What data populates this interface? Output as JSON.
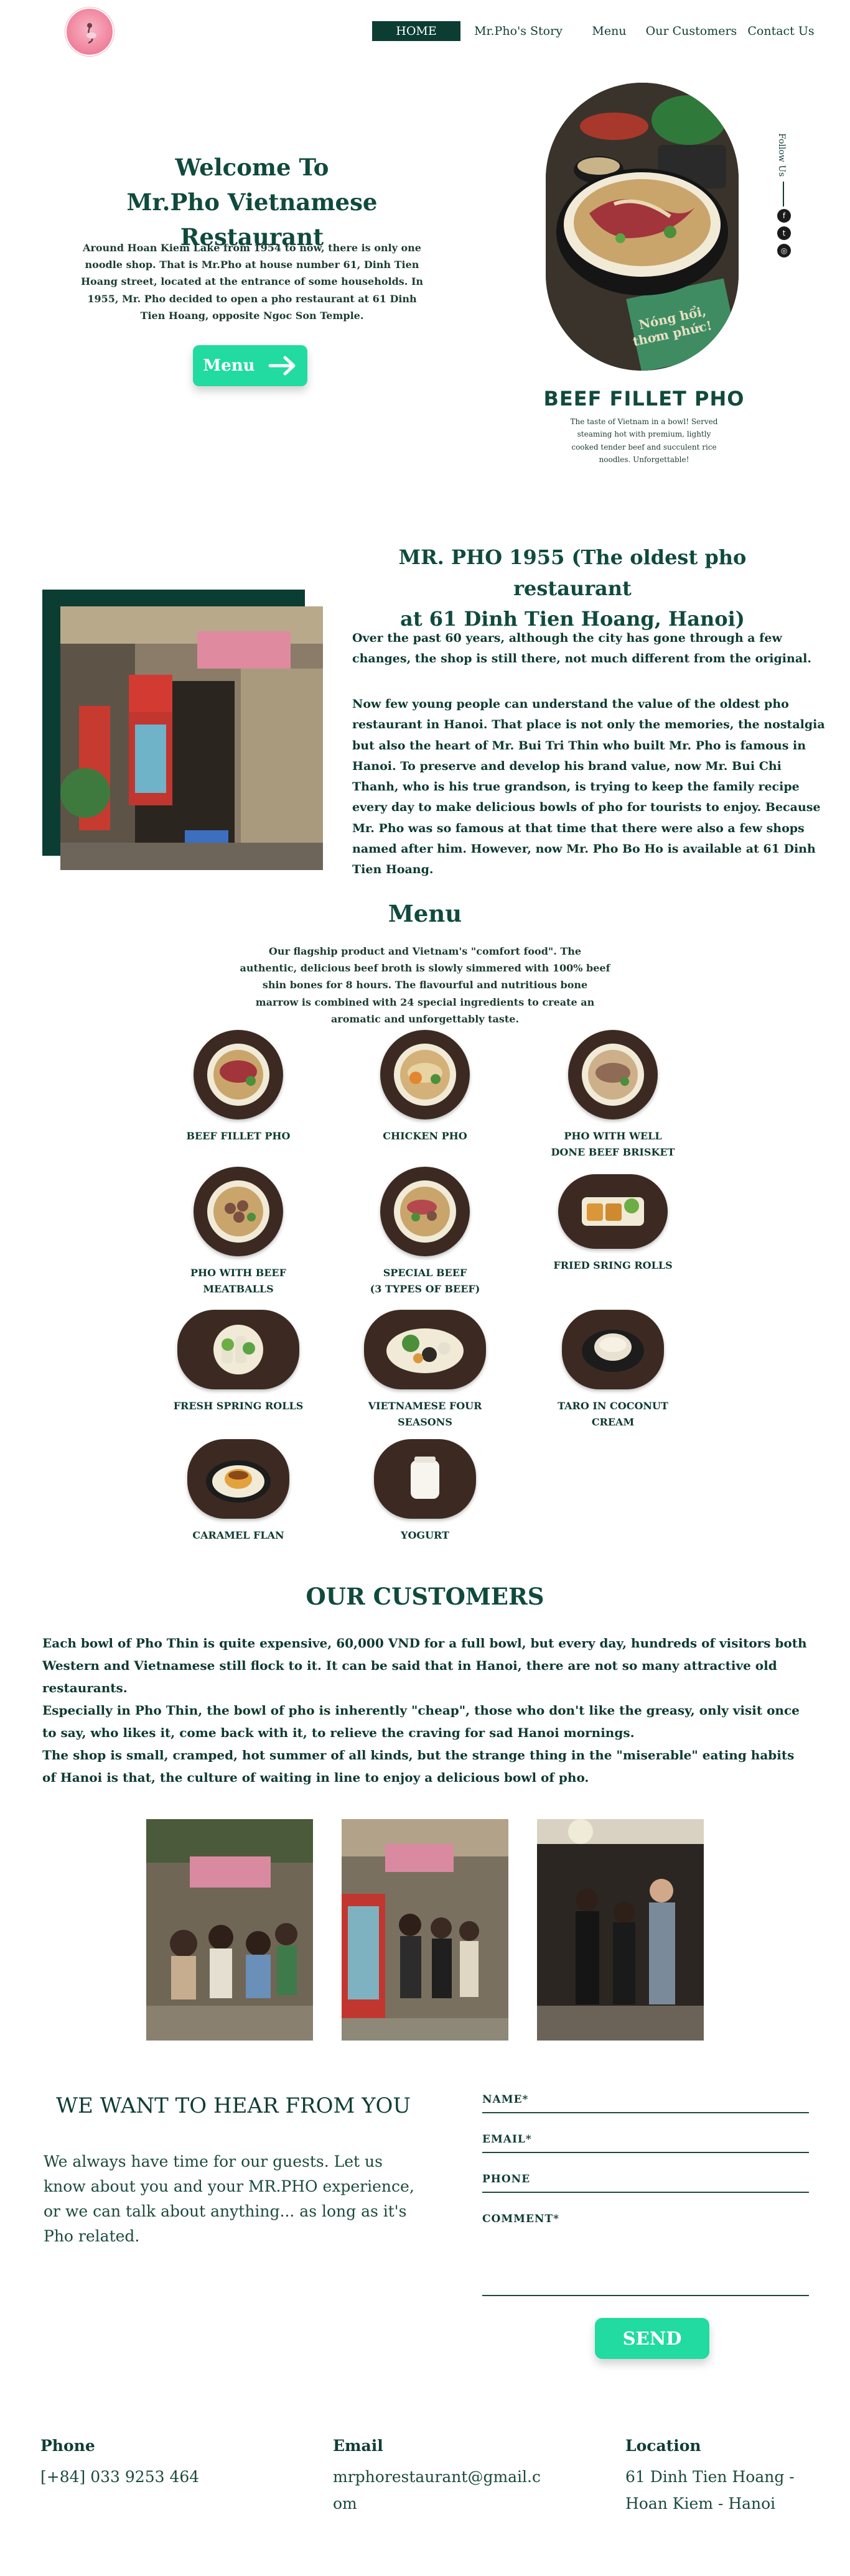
{
  "nav": {
    "home": "HOME",
    "story": "Mr.Pho's Story",
    "menu": "Menu",
    "customers": "Our Customers",
    "contact": "Contact Us"
  },
  "hero": {
    "title_line1": "Welcome To",
    "title_line2": "Mr.Pho Vietnamese Restaurant",
    "text": "Around Hoan Kiem Lake from 1954 to now, there is only one noodle shop. That is Mr.Pho at house number 61, Dinh Tien Hoang street, located at the entrance of some households. In 1955, Mr. Pho decided to open a pho restaurant at 61 Dinh Tien Hoang, opposite Ngoc Son Temple.",
    "menu_button": "Menu",
    "dish_title": "BEEF FILLET PHO",
    "dish_text": "The taste of Vietnam in a bowl! Served steaming hot with premium, lightly cooked tender beef and succulent rice noodles. Unforgettable!",
    "follow_label": "Follow Us"
  },
  "story": {
    "title_line1": "MR. PHO 1955 (The oldest pho restaurant",
    "title_line2": "at 61 Dinh Tien Hoang, Hanoi)",
    "para1": "Over the past 60 years, although the city has gone through a few changes, the shop is still there, not much different from the original.",
    "para2": "Now few young people can understand the value of the oldest pho restaurant in Hanoi. That place is not only the memories, the nostalgia but also the heart of Mr. Bui Tri Thin who built Mr. Pho is famous in Hanoi. To preserve and develop his brand value, now Mr. Bui Chi Thanh, who is his true grandson, is trying to keep the family recipe every day to make delicious bowls of pho for tourists to enjoy. Because Mr. Pho was so famous at that time that there were also a few shops named after him. However, now Mr. Pho Bo Ho is available at 61 Dinh Tien Hoang."
  },
  "menu": {
    "title": "Menu",
    "intro": "Our flagship product and Vietnam's \"comfort food\". The authentic, delicious beef broth is slowly simmered with 100% beef shin bones for 8 hours. The flavourful and nutritious bone marrow is combined with 24 special ingredients to create an aromatic and unforgettably taste.",
    "items": [
      {
        "line1": "BEEF FILLET PHO",
        "line2": ""
      },
      {
        "line1": "CHICKEN PHO",
        "line2": ""
      },
      {
        "line1": "PHO WITH WELL",
        "line2": "DONE BEEF BRISKET"
      },
      {
        "line1": "PHO WITH BEEF",
        "line2": "MEATBALLS"
      },
      {
        "line1": "SPECIAL BEEF",
        "line2": "(3 TYPES OF BEEF)"
      },
      {
        "line1": "FRIED SRING ROLLS",
        "line2": ""
      },
      {
        "line1": "FRESH SPRING ROLLS",
        "line2": ""
      },
      {
        "line1": "VIETNAMESE FOUR SEASONS",
        "line2": ""
      },
      {
        "line1": "TARO IN COCONUT CREAM",
        "line2": ""
      },
      {
        "line1": "CARAMEL FLAN",
        "line2": ""
      },
      {
        "line1": "YOGURT",
        "line2": ""
      }
    ]
  },
  "customers": {
    "title": "OUR CUSTOMERS",
    "para1": "Each bowl of Pho Thin is quite expensive, 60,000 VND for a full bowl, but every day, hundreds of visitors both Western and Vietnamese still flock to it. It can be said that in Hanoi, there are not so many attractive old restaurants.",
    "para2": "Especially in Pho Thin, the bowl of pho is inherently \"cheap\", those who don't like the greasy, only visit once to say, who likes it, come back with it, to relieve the craving for sad Hanoi mornings.",
    "para3": "The shop is small, cramped, hot summer of all kinds, but the strange thing in the \"miserable\" eating habits of Hanoi is that, the culture of waiting in line to enjoy a delicious bowl of pho."
  },
  "contact": {
    "title": "WE WANT TO HEAR FROM YOU",
    "text": "We always have time for our guests. Let us know about you and your MR.PHO experience, or we can talk about anything... as long as it's Pho related.",
    "name_label": "NAME*",
    "email_label": "EMAIL*",
    "phone_label": "PHONE",
    "comment_label": "COMMENT*",
    "send": "SEND"
  },
  "footer": {
    "phone_head": "Phone",
    "phone_val": "[+84] 033 9253 464",
    "email_head": "Email",
    "email_val1": "mrphorestaurant@gmail.c",
    "email_val2": "om",
    "location_head": "Location",
    "location_val1": "61 Dinh Tien Hoang -",
    "location_val2": "Hoan Kiem - Hanoi"
  },
  "colors": {
    "brand_dark": "#0b3d33",
    "accent_green": "#21dba0",
    "logo_pink": "#ef7f9a"
  }
}
